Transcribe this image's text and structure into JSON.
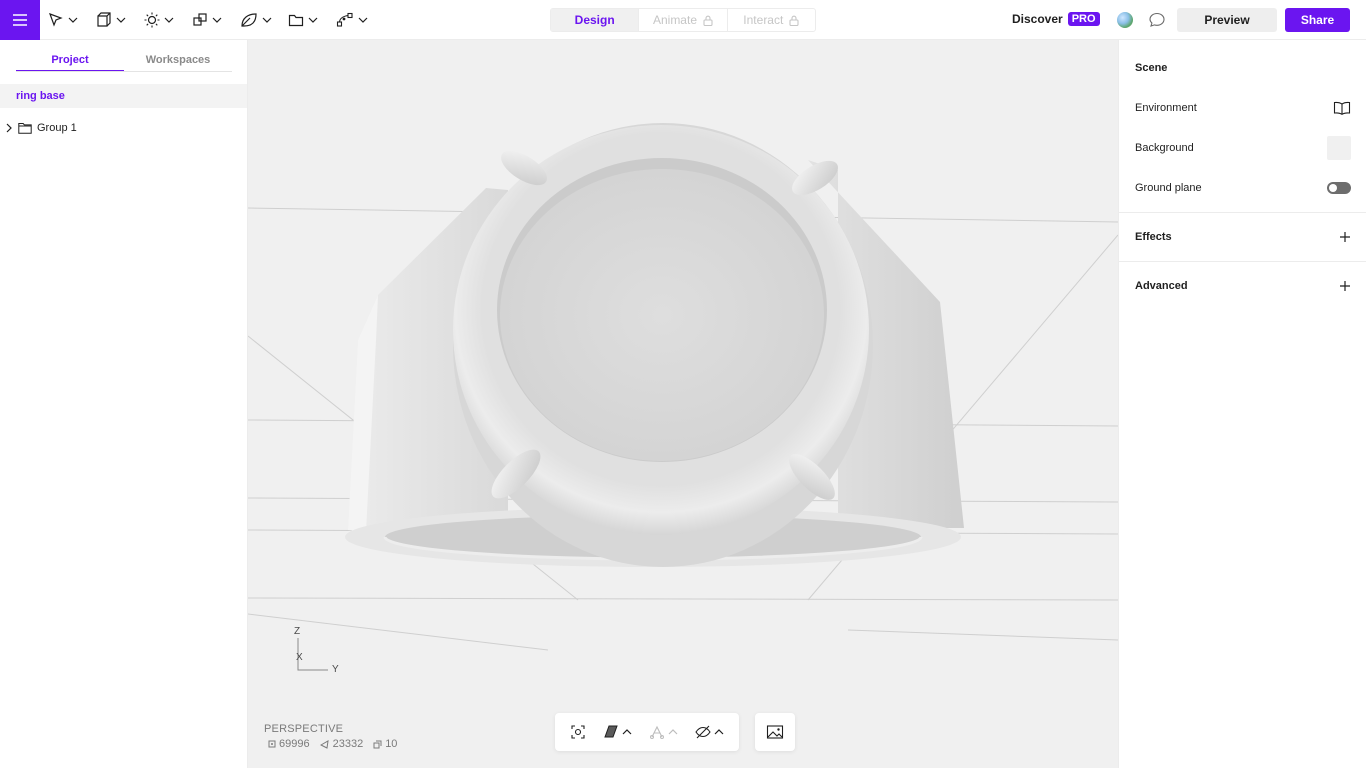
{
  "toolbar": {
    "modes": [
      {
        "label": "Design",
        "active": true,
        "locked": false
      },
      {
        "label": "Animate",
        "active": false,
        "locked": true
      },
      {
        "label": "Interact",
        "active": false,
        "locked": true
      }
    ],
    "discover_label": "Discover",
    "pro_badge": "PRO",
    "preview_label": "Preview",
    "share_label": "Share",
    "accent_color": "#6b15f0",
    "tool_icons": [
      "select-tool-icon",
      "cube-tool-icon",
      "light-tool-icon",
      "boolean-tool-icon",
      "material-tool-icon",
      "folder-tool-icon",
      "path-tool-icon"
    ]
  },
  "left_panel": {
    "tabs": [
      {
        "label": "Project",
        "active": true
      },
      {
        "label": "Workspaces",
        "active": false
      }
    ],
    "scene_name": "ring base",
    "tree": [
      {
        "label": "Group 1",
        "type": "folder",
        "expanded": false
      }
    ]
  },
  "viewport": {
    "camera_label": "PERSPECTIVE",
    "stats": {
      "vertices": "69996",
      "faces": "23332",
      "objects": "10"
    },
    "axes": {
      "z": "Z",
      "x": "X",
      "y": "Y"
    }
  },
  "right_panel": {
    "scene_heading": "Scene",
    "environment_label": "Environment",
    "background_label": "Background",
    "ground_plane_label": "Ground plane",
    "ground_plane_enabled": false,
    "effects_heading": "Effects",
    "advanced_heading": "Advanced"
  }
}
